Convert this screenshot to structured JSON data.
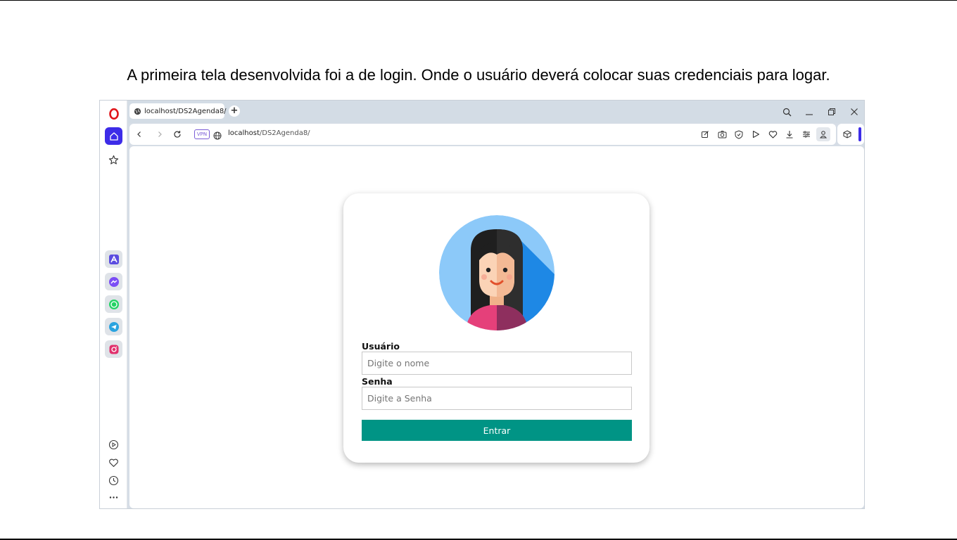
{
  "slide": {
    "caption": "A primeira tela desenvolvida foi a de login. Onde o usuário deverá colocar suas credenciais para logar."
  },
  "browser": {
    "tab_title": "localhost/DS2Agenda8/",
    "new_tab_label": "+",
    "vpn_badge": "VPN",
    "url_host": "localhost",
    "url_path": "/DS2Agenda8/",
    "accent_color": "#3d2ce8"
  },
  "sidebar": {
    "apps": [
      "aria",
      "messenger",
      "whatsapp",
      "telegram",
      "instagram"
    ],
    "bottom": [
      "player",
      "favorites",
      "history",
      "more"
    ]
  },
  "login": {
    "user_label": "Usuário",
    "user_placeholder": "Digite o nome",
    "password_label": "Senha",
    "password_placeholder": "Digite a Senha",
    "submit_label": "Entrar",
    "button_color": "#009485"
  }
}
